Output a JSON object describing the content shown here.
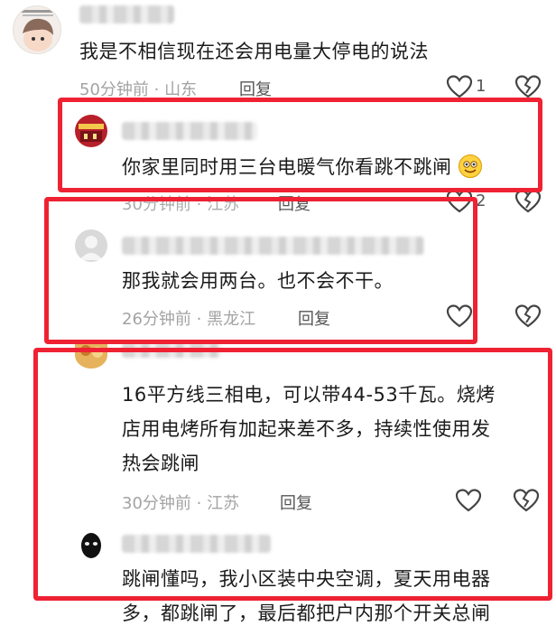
{
  "comments": [
    {
      "text": "我是不相信现在还会用电量大停电的说法",
      "time": "50分钟前",
      "location": "山东",
      "reply": "回复",
      "likes": "1"
    },
    {
      "text": "你家里同时用三台电暖气你看跳不跳闸",
      "time": "30分钟前",
      "location": "江苏",
      "reply": "回复",
      "likes": "2"
    },
    {
      "text": "那我就会用两台。也不会不干。",
      "time": "26分钟前",
      "location": "黑龙江",
      "reply": "回复"
    },
    {
      "text_lines": [
        "16平方线三相电，可以带44-53千瓦。烧烤",
        "店用电烤所有加起来差不多，持续性使用发",
        "热会跳闸"
      ],
      "time": "30分钟前",
      "location": "江苏",
      "reply": "回复"
    },
    {
      "text_lines": [
        "跳闸懂吗，我小区装中央空调，夏天用电器",
        "多，都跳闸了，最后都把户内那个开关总闸"
      ]
    }
  ],
  "separator": " · ",
  "icons": {
    "like": "heart-outline-icon",
    "dislike": "broken-heart-icon",
    "emoji": "grinning-emoji-icon"
  },
  "colors": {
    "highlight": "#ee2233",
    "meta": "#a3a3a3"
  }
}
